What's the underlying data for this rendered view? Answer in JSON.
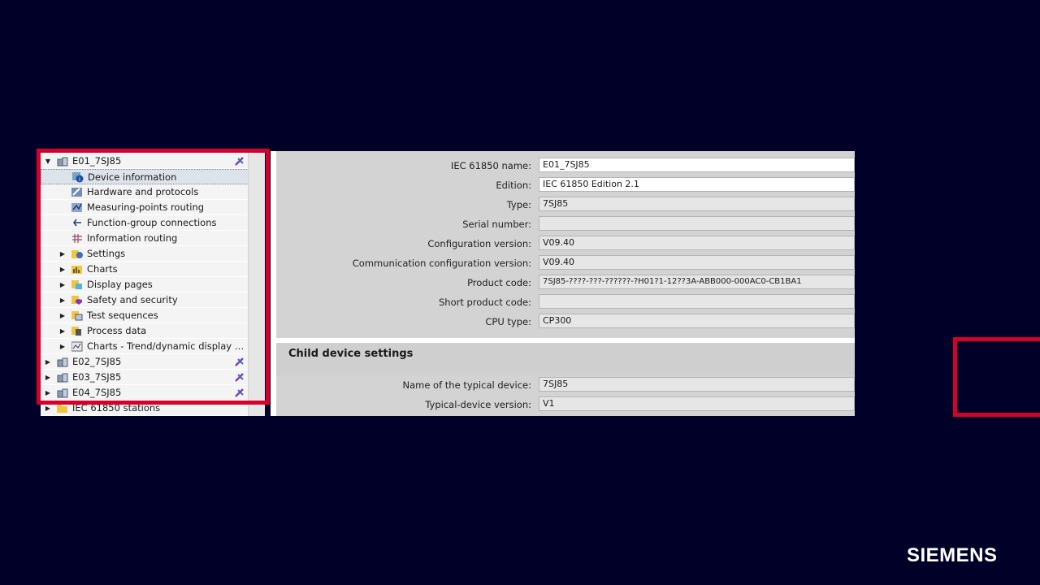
{
  "tree": {
    "items": [
      {
        "label": "E01_7SJ85",
        "level": 0,
        "expanded": true,
        "icon": "device-icon",
        "net": true,
        "selected": false
      },
      {
        "label": "Device information",
        "level": 1,
        "icon": "info-icon",
        "selected": true
      },
      {
        "label": "Hardware and protocols",
        "level": 1,
        "icon": "hardware-icon"
      },
      {
        "label": "Measuring-points routing",
        "level": 1,
        "icon": "measuring-icon"
      },
      {
        "label": "Function-group connections",
        "level": 1,
        "icon": "connections-icon"
      },
      {
        "label": "Information routing",
        "level": 1,
        "icon": "routing-grid-icon"
      },
      {
        "label": "Settings",
        "level": 1,
        "collapsed": true,
        "icon": "settings-folder-icon"
      },
      {
        "label": "Charts",
        "level": 1,
        "collapsed": true,
        "icon": "charts-folder-icon"
      },
      {
        "label": "Display pages",
        "level": 1,
        "collapsed": true,
        "icon": "display-folder-icon"
      },
      {
        "label": "Safety and security",
        "level": 1,
        "collapsed": true,
        "icon": "security-folder-icon"
      },
      {
        "label": "Test sequences",
        "level": 1,
        "collapsed": true,
        "icon": "test-folder-icon"
      },
      {
        "label": "Process data",
        "level": 1,
        "collapsed": true,
        "icon": "process-folder-icon"
      },
      {
        "label": "Charts - Trend/dynamic display & fo...",
        "level": 1,
        "collapsed": true,
        "icon": "trend-chart-icon"
      },
      {
        "label": "E02_7SJ85",
        "level": 0,
        "collapsed": true,
        "icon": "device-icon",
        "net": true
      },
      {
        "label": "E03_7SJ85",
        "level": 0,
        "collapsed": true,
        "icon": "device-icon",
        "net": true
      },
      {
        "label": "E04_7SJ85",
        "level": 0,
        "collapsed": true,
        "icon": "device-icon",
        "net": true
      },
      {
        "label": "IEC 61850 stations",
        "level": 0,
        "collapsed": true,
        "icon": "folder-icon"
      }
    ]
  },
  "properties": {
    "rows": [
      {
        "label": "IEC 61850 name:",
        "value": "E01_7SJ85",
        "editable": true
      },
      {
        "label": "Edition:",
        "value": "IEC 61850 Edition 2.1",
        "editable": true
      },
      {
        "label": "Type:",
        "value": "7SJ85",
        "editable": false
      },
      {
        "label": "Serial number:",
        "value": "",
        "editable": false
      },
      {
        "label": "Configuration version:",
        "value": "V09.40",
        "editable": false
      },
      {
        "label": "Communication configuration version:",
        "value": "V09.40",
        "editable": false
      },
      {
        "label": "Product code:",
        "value": "7SJ85-????-???-??????-?H01?1-12??3A-ABB000-000AC0-CB1BA1",
        "editable": false
      },
      {
        "label": "Short product code:",
        "value": "",
        "editable": false
      },
      {
        "label": "CPU type:",
        "value": "CP300",
        "editable": false
      }
    ],
    "child_section_title": "Child device settings",
    "child_rows": [
      {
        "label": "Name of the typical device:",
        "value": "7SJ85",
        "editable": false
      },
      {
        "label": "Typical-device version:",
        "value": "V1",
        "editable": false
      }
    ]
  },
  "brand": {
    "logo": "SIEMENS"
  },
  "colors": {
    "background": "#000028",
    "highlight_frame": "#d6002a"
  }
}
